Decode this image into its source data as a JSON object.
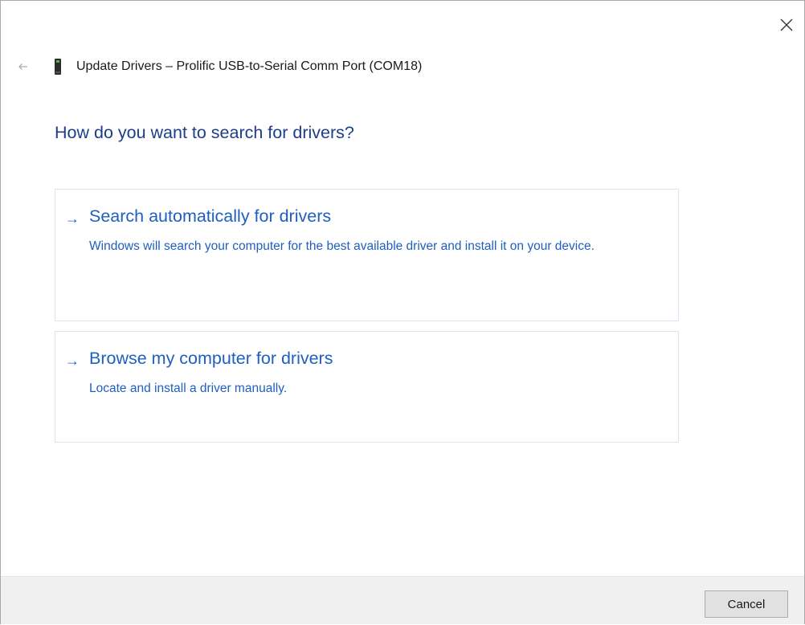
{
  "window": {
    "title": "Update Drivers – Prolific USB-to-Serial Comm Port (COM18)"
  },
  "icons": {
    "close": "close-icon",
    "back": "back-arrow-icon",
    "device": "usb-device-icon",
    "option_arrow": "right-arrow-icon"
  },
  "main": {
    "question": "How do you want to search for drivers?",
    "options": [
      {
        "arrow": "→",
        "title": "Search automatically for drivers",
        "description": "Windows will search your computer for the best available driver and install it on your device."
      },
      {
        "arrow": "→",
        "title": "Browse my computer for drivers",
        "description": "Locate and install a driver manually."
      }
    ]
  },
  "footer": {
    "cancel_label": "Cancel"
  },
  "colors": {
    "heading": "#1c3e8a",
    "link": "#1f5fbf",
    "footer_bg": "#f0f0f0"
  }
}
